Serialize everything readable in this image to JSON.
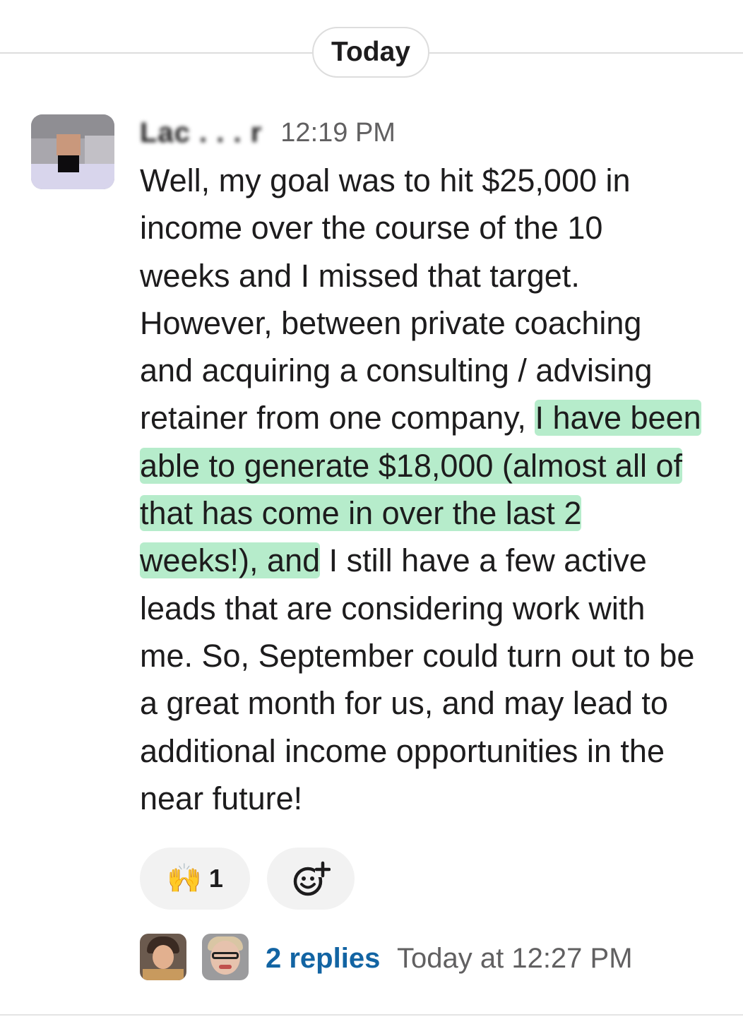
{
  "date_divider": {
    "label": "Today"
  },
  "message": {
    "sender_name": "Lac . . . r",
    "timestamp": "12:19 PM",
    "lines": [
      {
        "pre": "Well, my goal was to hit $25,000 in",
        "hl": ""
      },
      {
        "pre": "income over the course of the 10",
        "hl": ""
      },
      {
        "pre": "weeks and I missed that target.",
        "hl": ""
      },
      {
        "pre": "However, between private coaching",
        "hl": ""
      },
      {
        "pre": "and acquiring a consulting / advising",
        "hl": ""
      },
      {
        "pre": "retainer from one company, ",
        "hl": "I have been"
      },
      {
        "pre": "",
        "hl": "able to generate $18,000 (almost all of"
      },
      {
        "pre": "",
        "hl": "that has come in over the last 2"
      },
      {
        "pre": "",
        "hl": "weeks!), and",
        "post": " I still have a few active"
      },
      {
        "pre": "leads that are considering work with",
        "hl": ""
      },
      {
        "pre": "me. So, September could turn out to be",
        "hl": ""
      },
      {
        "pre": "a great month for us, and may lead to",
        "hl": ""
      },
      {
        "pre": "additional income opportunities in the",
        "hl": ""
      },
      {
        "pre": "near future!",
        "hl": ""
      }
    ],
    "highlight_color": "#b6eccb"
  },
  "reactions": [
    {
      "emoji": "🙌",
      "count": "1"
    }
  ],
  "add_reaction_icon": "add-reaction-icon",
  "thread": {
    "replies_label": "2 replies",
    "last_reply": "Today at 12:27 PM",
    "link_color": "#1264a3"
  }
}
